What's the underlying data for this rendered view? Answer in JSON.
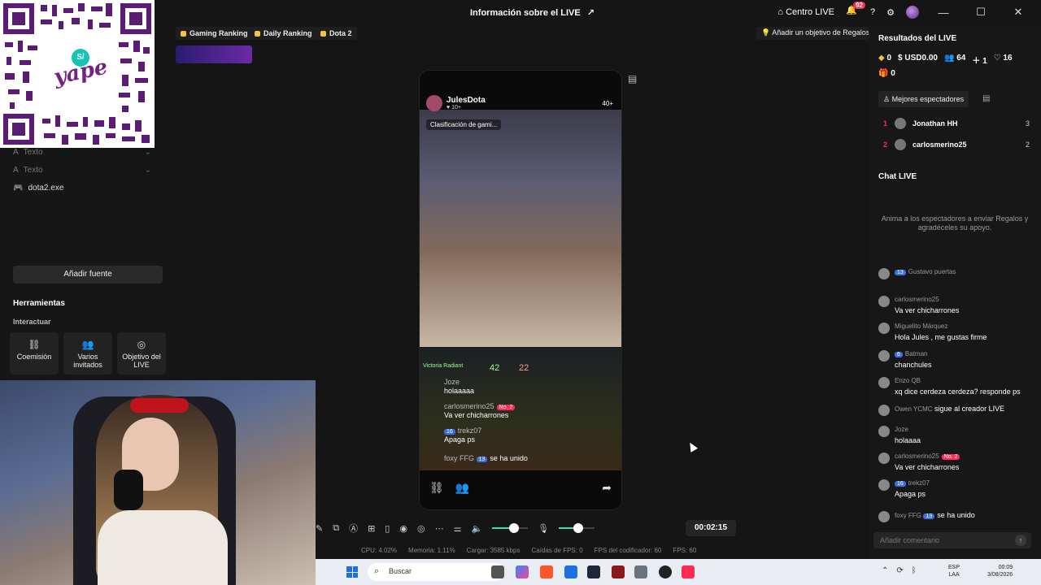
{
  "titlebar": {
    "title": "Información sobre el LIVE",
    "centro_live": "Centro LIVE",
    "notif_count": "92",
    "minimize": "—",
    "maximize": "☐",
    "close": "✕"
  },
  "chips": {
    "gaming": "Gaming Ranking",
    "daily": "Daily Ranking",
    "dota": "Dota 2",
    "goal": "Añadir un objetivo de Regalos"
  },
  "sidebar": {
    "sources": [
      {
        "label": "Texto"
      },
      {
        "label": "Texto"
      },
      {
        "label": "dota2.exe"
      }
    ],
    "add_source": "Añadir fuente",
    "tools_title": "Herramientas",
    "tools_sub": "Interactuar",
    "tools": [
      {
        "label": "Coemisión",
        "icon": "link-icon"
      },
      {
        "label": "Varios invitados",
        "icon": "users-icon"
      },
      {
        "label": "Objetivo del LIVE",
        "icon": "target-icon"
      }
    ]
  },
  "preview": {
    "streamer": "JulesDota",
    "likes": "♥ 10+",
    "viewers": "40+",
    "clasificacion": "Clasificación de gami...",
    "overlay": {
      "victoria": "Victoria Radiant",
      "score_a": "42",
      "score_b": "22",
      "chat": [
        {
          "name": "Joze",
          "text": "holaaaaa"
        },
        {
          "name": "carlosmerino25",
          "badge": "No. 2",
          "text": "Va ver chicharrones"
        },
        {
          "name": "trekz07",
          "lvl": "16",
          "text": "Apaga ps"
        }
      ],
      "joined_name": "foxy FFG",
      "joined_lvl": "13",
      "joined_text": "se ha unido"
    }
  },
  "controls": {
    "timer": "00:02:15",
    "volume_level": 0.6,
    "mic_level": 0.55
  },
  "stats": {
    "cpu": "CPU: 4.02%",
    "memoria": "Memoria: 1.11%",
    "cargar": "Cargar: 3585 kbps",
    "caidas": "Caídas de FPS: 0",
    "fps_cod": "FPS del codificador: 60",
    "fps": "FPS: 60"
  },
  "right": {
    "results_title": "Resultados del LIVE",
    "diamonds": "0",
    "usd": "USD0.00",
    "viewers": "64",
    "new_followers": "1",
    "likes": "16",
    "gifts": "0",
    "best_viewers": "Mejores espectadores",
    "ranking": [
      {
        "pos": "1",
        "name": "Jonathan HH",
        "value": "3"
      },
      {
        "pos": "2",
        "name": "carlosmerino25",
        "value": "2"
      }
    ],
    "chat_title": "Chat LIVE",
    "chat_empty": "Anima a los espectadores a enviar Regalos y agradéceles su apoyo.",
    "messages": [
      {
        "lvl": "13",
        "name": "Gustavo puertas",
        "text": ""
      },
      {
        "name": "carlosmerino25",
        "text": "Va ver chicharrones"
      },
      {
        "name": "Miguelito Márquez",
        "text": "Hola Jules , me gustas firme"
      },
      {
        "lvl": "6",
        "name": "Batman",
        "text": "chanchules"
      },
      {
        "name": "Enzo QB",
        "text": "xq dice cerdeza cerdeza? responde ps"
      },
      {
        "name": "Owen YCMC",
        "inline": "sigue al creador LIVE"
      },
      {
        "name": "Joze",
        "text": "holaaaa"
      },
      {
        "name": "carlosmerino25",
        "badge": "No. 2",
        "text": "Va ver chicharrones"
      },
      {
        "lvl": "16",
        "name": "trekz07",
        "text": "Apaga ps"
      },
      {
        "name": "foxy FFG",
        "lvl2": "13",
        "inline": "se ha unido"
      }
    ],
    "comment_placeholder": "Añadir comentario"
  },
  "taskbar": {
    "search": "Buscar",
    "lang1": "ESP",
    "lang2": "LAA",
    "time": "00:09",
    "date": "3/08/2026"
  }
}
